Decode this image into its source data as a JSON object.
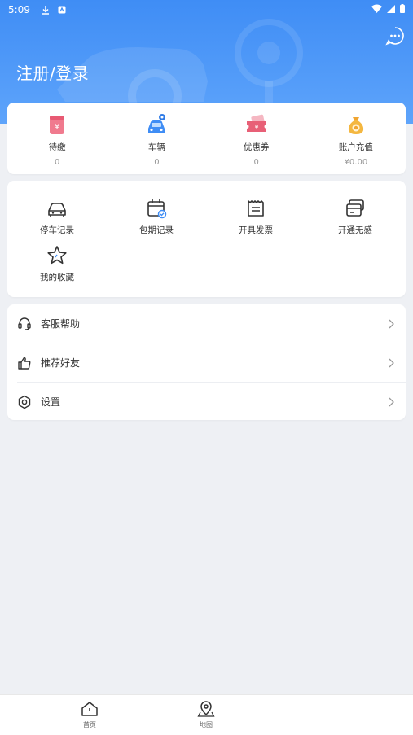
{
  "status_bar": {
    "time": "5:09"
  },
  "header": {
    "login_text": "注册/登录"
  },
  "stats": [
    {
      "icon": "pending-payment-icon",
      "label": "待缴",
      "value": "0"
    },
    {
      "icon": "vehicle-icon",
      "label": "车辆",
      "value": "0"
    },
    {
      "icon": "coupon-icon",
      "label": "优惠券",
      "value": "0"
    },
    {
      "icon": "money-bag-icon",
      "label": "账户充值",
      "value": "¥0.00"
    }
  ],
  "functions": [
    {
      "icon": "car-outline-icon",
      "label": "停车记录"
    },
    {
      "icon": "calendar-icon",
      "label": "包期记录"
    },
    {
      "icon": "invoice-icon",
      "label": "开具发票"
    },
    {
      "icon": "card-icon",
      "label": "开通无感"
    },
    {
      "icon": "star-icon",
      "label": "我的收藏"
    }
  ],
  "menu": [
    {
      "icon": "headset-icon",
      "label": "客服帮助"
    },
    {
      "icon": "thumbs-up-icon",
      "label": "推荐好友"
    },
    {
      "icon": "gear-icon",
      "label": "设置"
    }
  ],
  "tabs": [
    {
      "icon": "home-icon",
      "label": "首页"
    },
    {
      "icon": "map-pin-icon",
      "label": "地图"
    }
  ],
  "colors": {
    "primary": "#3f8df5",
    "background": "#eef0f4"
  }
}
